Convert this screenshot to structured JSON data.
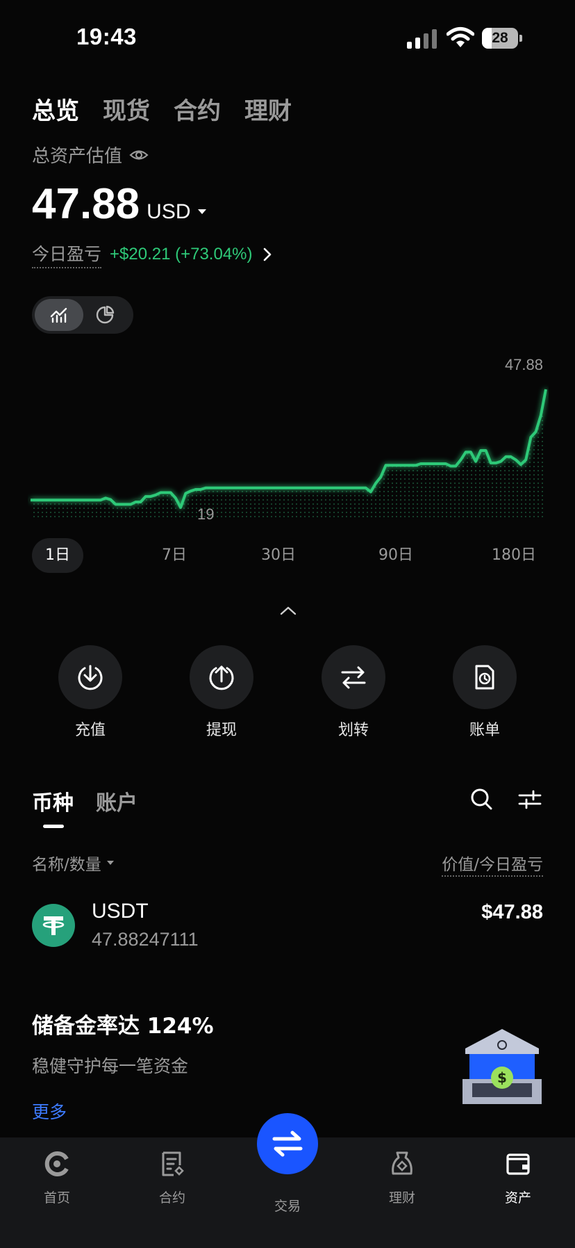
{
  "status_bar": {
    "time": "19:43",
    "battery": "28"
  },
  "top_tabs": [
    {
      "label": "总览",
      "active": true
    },
    {
      "label": "现货",
      "active": false
    },
    {
      "label": "合约",
      "active": false
    },
    {
      "label": "理财",
      "active": false
    }
  ],
  "summary": {
    "label": "总资产估值",
    "value": "47.88",
    "unit": "USD",
    "pnl_label": "今日盈亏",
    "pnl_value": "+$20.21 (+73.04%)"
  },
  "chart": {
    "max_label": "47.88",
    "min_label": "19",
    "line_color": "#2ec978"
  },
  "chart_data": {
    "type": "line",
    "title": "",
    "xlabel": "",
    "ylabel": "",
    "ylim": [
      19,
      47.88
    ],
    "series": [
      {
        "values": [
          19.5,
          19.5,
          19.5,
          19.5,
          19.5,
          19.5,
          19.5,
          19.5,
          19.5,
          19.5,
          19.5,
          19.5,
          19.5,
          19.5,
          19.5,
          20.0,
          19.6,
          18.4,
          18.4,
          18.4,
          18.4,
          19.0,
          19.0,
          20.4,
          20.4,
          20.8,
          21.4,
          21.4,
          21.4,
          20.0,
          17.6,
          21.2,
          21.8,
          22.2,
          22.2,
          22.6,
          22.6,
          22.6,
          22.6,
          22.6,
          22.6,
          22.6,
          22.6,
          22.6,
          22.6,
          22.6,
          22.6,
          22.6,
          22.6,
          22.6,
          22.6,
          22.6,
          22.6,
          22.6,
          22.6,
          22.6,
          22.6,
          22.6,
          22.6,
          22.6,
          22.6,
          22.6,
          22.6,
          22.6,
          22.6,
          22.6,
          22.6,
          22.6,
          21.6,
          23.8,
          25.4,
          28.4,
          28.4,
          28.4,
          28.4,
          28.4,
          28.4,
          28.4,
          28.8,
          28.8,
          28.8,
          28.8,
          28.8,
          28.8,
          28.2,
          28.2,
          29.8,
          31.8,
          31.8,
          29.4,
          32.2,
          32.2,
          29.0,
          29.0,
          29.4,
          30.6,
          30.6,
          29.8,
          28.6,
          29.8,
          35.6,
          37.0,
          41.2,
          47.88
        ]
      }
    ]
  },
  "ranges": [
    {
      "label": "1日",
      "active": true
    },
    {
      "label": "7日",
      "active": false
    },
    {
      "label": "30日",
      "active": false
    },
    {
      "label": "90日",
      "active": false
    },
    {
      "label": "180日",
      "active": false
    }
  ],
  "actions": [
    {
      "label": "充值",
      "icon": "deposit-icon"
    },
    {
      "label": "提现",
      "icon": "withdraw-icon"
    },
    {
      "label": "划转",
      "icon": "transfer-icon"
    },
    {
      "label": "账单",
      "icon": "bill-icon"
    }
  ],
  "section_tabs": [
    {
      "label": "币种",
      "active": true
    },
    {
      "label": "账户",
      "active": false
    }
  ],
  "list_header": {
    "left": "名称/数量",
    "right": "价值/今日盈亏"
  },
  "coins": [
    {
      "name": "USDT",
      "quantity": "47.88247111",
      "value": "$47.88"
    }
  ],
  "promo": {
    "title": "储备金率达 124%",
    "subtitle": "稳健守护每一笔资金",
    "link": "更多"
  },
  "bottom_nav": [
    {
      "label": "首页",
      "icon": "home-icon"
    },
    {
      "label": "合约",
      "icon": "contract-icon"
    },
    {
      "label": "交易",
      "icon": "trade-icon"
    },
    {
      "label": "理财",
      "icon": "earn-icon"
    },
    {
      "label": "资产",
      "icon": "assets-icon",
      "active": true
    }
  ],
  "colors": {
    "accent_green": "#2ec978",
    "brand_blue": "#1a55ff",
    "link_blue": "#3d7bff",
    "usdt_green": "#26a17b"
  }
}
